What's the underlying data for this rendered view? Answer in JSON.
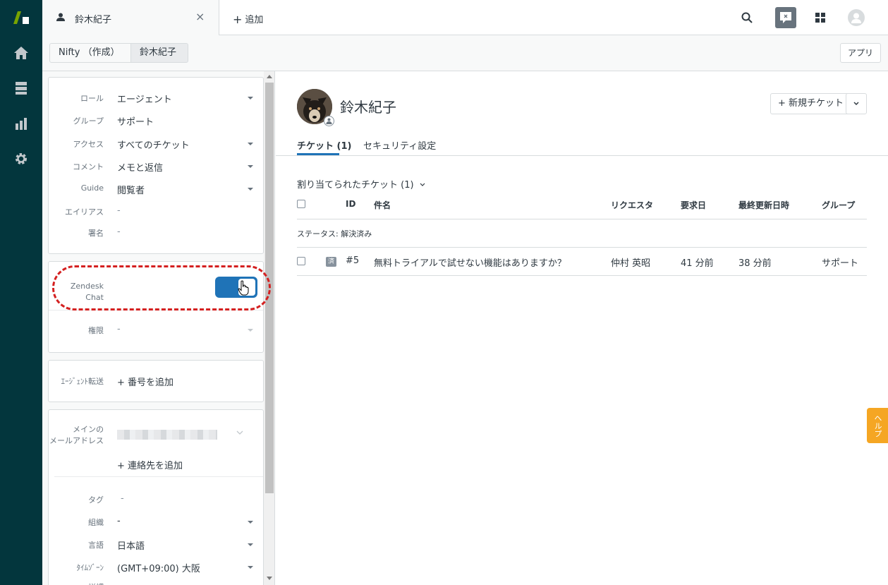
{
  "topbar": {
    "active_tab": "鈴木紀子",
    "close": "×",
    "add_tab": "追加",
    "add_plus": "+"
  },
  "breadcrumb": {
    "org": "Nifty （作成）",
    "user": "鈴木紀子",
    "apps_button": "アプリ"
  },
  "left_panel": {
    "fields": [
      {
        "label": "ロール",
        "value": "エージェント"
      },
      {
        "label": "グループ",
        "value": "サポート"
      },
      {
        "label": "アクセス",
        "value": "すべてのチケット"
      },
      {
        "label": "コメント",
        "value": "メモと返信"
      },
      {
        "label": "Guide",
        "value": "閲覧者"
      },
      {
        "label": "エイリアス",
        "value": "-"
      },
      {
        "label": "署名",
        "value": "-"
      }
    ],
    "chat": {
      "label_line1": "Zendesk",
      "label_line2": "Chat",
      "enabled": true
    },
    "permission": {
      "label": "権限",
      "value": "-"
    },
    "agent_forward": {
      "label": "ｴｰｼﾞｪﾝﾄ転送",
      "add": "+ 番号を追加"
    },
    "contact": {
      "email_label_line1": "メインの",
      "email_label_line2": "メールアドレス",
      "add_contact": "+ 連絡先を追加"
    },
    "more_fields": [
      {
        "label": "タグ",
        "value": "-"
      },
      {
        "label": "組織",
        "value": "-"
      },
      {
        "label": "言語",
        "value": "日本語"
      },
      {
        "label": "ﾀｲﾑｿﾞｰﾝ",
        "value": "(GMT+09:00) 大阪"
      },
      {
        "label": "詳細",
        "value": "-"
      }
    ]
  },
  "main": {
    "user_name": "鈴木紀子",
    "new_ticket": "+ 新規チケット",
    "tabs": [
      {
        "label": "チケット (1)",
        "active": true
      },
      {
        "label": "セキュリティ設定",
        "active": false
      }
    ],
    "section_title": "割り当てられたチケット (1)",
    "columns": [
      "ID",
      "件名",
      "リクエスタ",
      "要求日",
      "最終更新日時",
      "グループ"
    ],
    "group_label": "ステータス: 解決済み",
    "rows": [
      {
        "badge": "済",
        "id": "#5",
        "subject": "無料トライアルで試せない機能はありますか？",
        "requester": "仲村 英昭",
        "requested": "41 分前",
        "updated": "38 分前",
        "group": "サポート"
      }
    ]
  },
  "help": {
    "label": "ヘルプ"
  },
  "colors": {
    "nav_bg": "#03363d",
    "accent": "#1f73b7",
    "highlight": "#d42020",
    "help": "#f5a623"
  }
}
